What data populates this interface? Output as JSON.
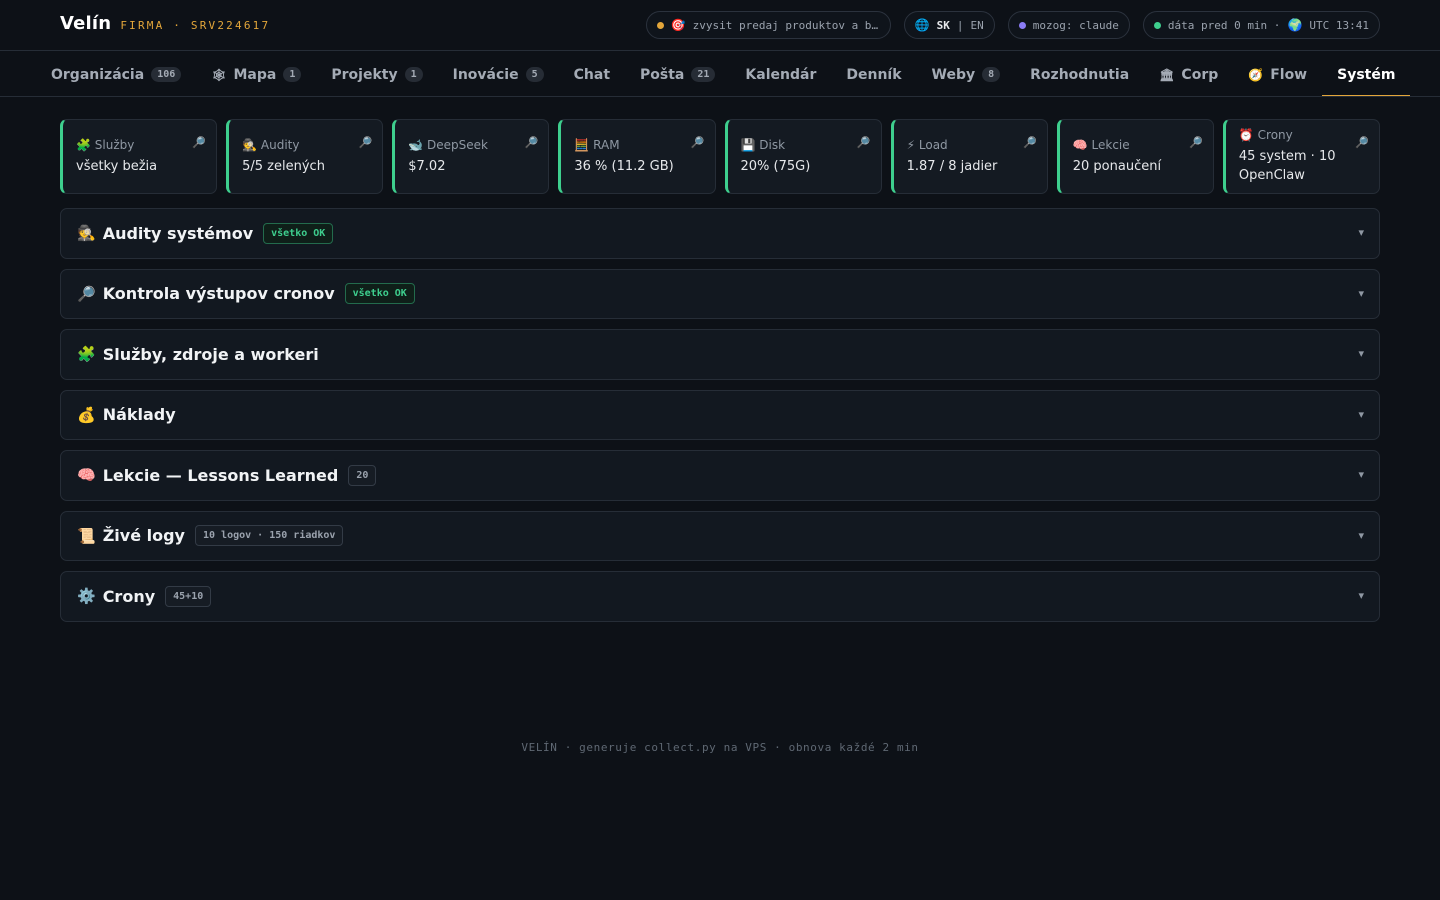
{
  "header": {
    "brand": "Velín",
    "subtitle": "FIRMA · SRV224617",
    "goal": {
      "icon": "🎯",
      "text": "zvysit predaj produktov a by…",
      "dot_color": "#e3a63a"
    },
    "lang": {
      "icon": "🌐",
      "active": "SK",
      "separator": "|",
      "other": "EN"
    },
    "brain": {
      "text": "mozog: claude",
      "dot_color": "#8b7cf6"
    },
    "status": {
      "text": "dáta pred 0 min ·",
      "globe": "🌍",
      "time": "UTC 13:41",
      "dot_color": "#3ecf8e"
    }
  },
  "nav": {
    "tabs": [
      {
        "label": "Organizácia",
        "icon": "",
        "badge": "106"
      },
      {
        "label": "Mapa",
        "icon": "🕸",
        "badge": "1"
      },
      {
        "label": "Projekty",
        "icon": "",
        "badge": "1"
      },
      {
        "label": "Inovácie",
        "icon": "",
        "badge": "5"
      },
      {
        "label": "Chat",
        "icon": "",
        "badge": ""
      },
      {
        "label": "Pošta",
        "icon": "",
        "badge": "21"
      },
      {
        "label": "Kalendár",
        "icon": "",
        "badge": ""
      },
      {
        "label": "Denník",
        "icon": "",
        "badge": ""
      },
      {
        "label": "Weby",
        "icon": "",
        "badge": "8"
      },
      {
        "label": "Rozhodnutia",
        "icon": "",
        "badge": ""
      },
      {
        "label": "Corp",
        "icon": "🏛",
        "badge": ""
      },
      {
        "label": "Flow",
        "icon": "🧭",
        "badge": ""
      },
      {
        "label": "Systém",
        "icon": "",
        "badge": "",
        "active": true
      }
    ]
  },
  "cards": [
    {
      "icon": "🧩",
      "label": "Služby",
      "value": "všetky bežia",
      "accent": "#3ecf8e"
    },
    {
      "icon": "🕵",
      "label": "Audity",
      "value": "5/5 zelených",
      "accent": "#3ecf8e"
    },
    {
      "icon": "🐋",
      "label": "DeepSeek",
      "value": "$7.02",
      "accent": "#3ecf8e"
    },
    {
      "icon": "🧮",
      "label": "RAM",
      "value": "36 % (11.2 GB)",
      "accent": "#3ecf8e"
    },
    {
      "icon": "💾",
      "label": "Disk",
      "value": "20% (75G)",
      "accent": "#3ecf8e"
    },
    {
      "icon": "⚡",
      "label": "Load",
      "value": "1.87 / 8 jadier",
      "accent": "#3ecf8e"
    },
    {
      "icon": "🧠",
      "label": "Lekcie",
      "value": "20 ponaučení",
      "accent": "#3ecf8e"
    },
    {
      "icon": "⏰",
      "label": "Crony",
      "value": "45 system · 10 OpenClaw",
      "accent": "#3ecf8e"
    }
  ],
  "card_zoom_icon": "🔎",
  "sections": [
    {
      "icon": "🕵",
      "title": "Audity systémov",
      "badge": "všetko OK",
      "badge_ok": true
    },
    {
      "icon": "🔎",
      "title": "Kontrola výstupov cronov",
      "badge": "všetko OK",
      "badge_ok": true
    },
    {
      "icon": "🧩",
      "title": "Služby, zdroje a workeri",
      "badge": "",
      "badge_ok": false
    },
    {
      "icon": "💰",
      "title": "Náklady",
      "badge": "",
      "badge_ok": false
    },
    {
      "icon": "🧠",
      "title": "Lekcie — Lessons Learned",
      "badge": "20",
      "badge_ok": false
    },
    {
      "icon": "📜",
      "title": "Živé logy",
      "badge": "10 logov · 150 riadkov",
      "badge_ok": false
    },
    {
      "icon": "⚙️",
      "title": "Crony",
      "badge": "45+10",
      "badge_ok": false
    }
  ],
  "chevron": "▾",
  "footer": "VELÍN · generuje collect.py na VPS · obnova každé 2 min"
}
